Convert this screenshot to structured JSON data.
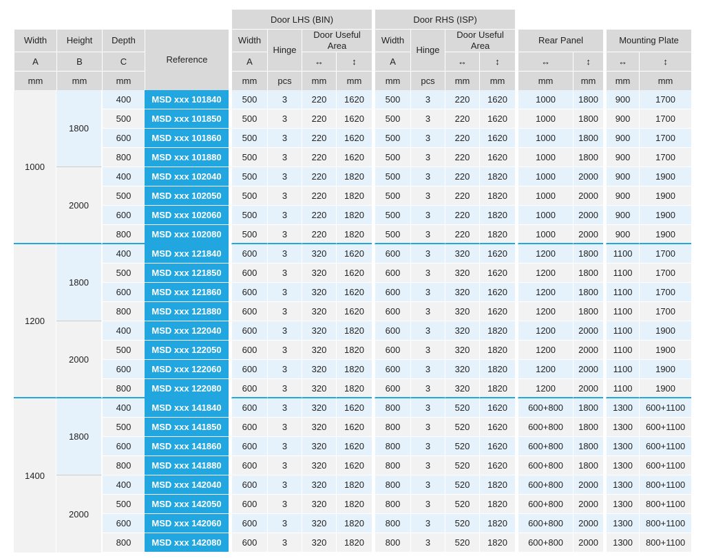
{
  "headers": {
    "width": "Width",
    "height": "Height",
    "depth": "Depth",
    "reference": "Reference",
    "a": "A",
    "b": "B",
    "c": "C",
    "mm": "mm",
    "pcs": "pcs",
    "door_lhs": "Door LHS (BIN)",
    "door_rhs": "Door RHS (ISP)",
    "door_width": "Width",
    "hinge": "Hinge",
    "door_useful_area": "Door Useful Area",
    "rear_panel": "Rear Panel",
    "mounting_plate": "Mounting Plate",
    "horizontal_icon": "↔",
    "vertical_icon": "↕"
  },
  "width_groups": [
    {
      "width": "1000",
      "height_groups": [
        {
          "height": "1800",
          "rows": [
            [
              "400",
              "MSD xxx 101840",
              "500",
              "3",
              "220",
              "1620",
              "500",
              "3",
              "220",
              "1620",
              "1000",
              "1800",
              "900",
              "1700"
            ],
            [
              "500",
              "MSD xxx 101850",
              "500",
              "3",
              "220",
              "1620",
              "500",
              "3",
              "220",
              "1620",
              "1000",
              "1800",
              "900",
              "1700"
            ],
            [
              "600",
              "MSD xxx 101860",
              "500",
              "3",
              "220",
              "1620",
              "500",
              "3",
              "220",
              "1620",
              "1000",
              "1800",
              "900",
              "1700"
            ],
            [
              "800",
              "MSD xxx 101880",
              "500",
              "3",
              "220",
              "1620",
              "500",
              "3",
              "220",
              "1620",
              "1000",
              "1800",
              "900",
              "1700"
            ]
          ]
        },
        {
          "height": "2000",
          "rows": [
            [
              "400",
              "MSD xxx 102040",
              "500",
              "3",
              "220",
              "1820",
              "500",
              "3",
              "220",
              "1820",
              "1000",
              "2000",
              "900",
              "1900"
            ],
            [
              "500",
              "MSD xxx 102050",
              "500",
              "3",
              "220",
              "1820",
              "500",
              "3",
              "220",
              "1820",
              "1000",
              "2000",
              "900",
              "1900"
            ],
            [
              "600",
              "MSD xxx 102060",
              "500",
              "3",
              "220",
              "1820",
              "500",
              "3",
              "220",
              "1820",
              "1000",
              "2000",
              "900",
              "1900"
            ],
            [
              "800",
              "MSD xxx 102080",
              "500",
              "3",
              "220",
              "1820",
              "500",
              "3",
              "220",
              "1820",
              "1000",
              "2000",
              "900",
              "1900"
            ]
          ]
        }
      ]
    },
    {
      "width": "1200",
      "height_groups": [
        {
          "height": "1800",
          "rows": [
            [
              "400",
              "MSD xxx 121840",
              "600",
              "3",
              "320",
              "1620",
              "600",
              "3",
              "320",
              "1620",
              "1200",
              "1800",
              "1100",
              "1700"
            ],
            [
              "500",
              "MSD xxx 121850",
              "600",
              "3",
              "320",
              "1620",
              "600",
              "3",
              "320",
              "1620",
              "1200",
              "1800",
              "1100",
              "1700"
            ],
            [
              "600",
              "MSD xxx 121860",
              "600",
              "3",
              "320",
              "1620",
              "600",
              "3",
              "320",
              "1620",
              "1200",
              "1800",
              "1100",
              "1700"
            ],
            [
              "800",
              "MSD xxx 121880",
              "600",
              "3",
              "320",
              "1620",
              "600",
              "3",
              "320",
              "1620",
              "1200",
              "1800",
              "1100",
              "1700"
            ]
          ]
        },
        {
          "height": "2000",
          "rows": [
            [
              "400",
              "MSD xxx 122040",
              "600",
              "3",
              "320",
              "1820",
              "600",
              "3",
              "320",
              "1820",
              "1200",
              "2000",
              "1100",
              "1900"
            ],
            [
              "500",
              "MSD xxx 122050",
              "600",
              "3",
              "320",
              "1820",
              "600",
              "3",
              "320",
              "1820",
              "1200",
              "2000",
              "1100",
              "1900"
            ],
            [
              "600",
              "MSD xxx 122060",
              "600",
              "3",
              "320",
              "1820",
              "600",
              "3",
              "320",
              "1820",
              "1200",
              "2000",
              "1100",
              "1900"
            ],
            [
              "800",
              "MSD xxx 122080",
              "600",
              "3",
              "320",
              "1820",
              "600",
              "3",
              "320",
              "1820",
              "1200",
              "2000",
              "1100",
              "1900"
            ]
          ]
        }
      ]
    },
    {
      "width": "1400",
      "height_groups": [
        {
          "height": "1800",
          "rows": [
            [
              "400",
              "MSD xxx 141840",
              "600",
              "3",
              "320",
              "1620",
              "800",
              "3",
              "520",
              "1620",
              "600+800",
              "1800",
              "1300",
              "600+1100"
            ],
            [
              "500",
              "MSD xxx 141850",
              "600",
              "3",
              "320",
              "1620",
              "800",
              "3",
              "520",
              "1620",
              "600+800",
              "1800",
              "1300",
              "600+1100"
            ],
            [
              "600",
              "MSD xxx 141860",
              "600",
              "3",
              "320",
              "1620",
              "800",
              "3",
              "520",
              "1620",
              "600+800",
              "1800",
              "1300",
              "600+1100"
            ],
            [
              "800",
              "MSD xxx 141880",
              "600",
              "3",
              "320",
              "1620",
              "800",
              "3",
              "520",
              "1620",
              "600+800",
              "1800",
              "1300",
              "600+1100"
            ]
          ]
        },
        {
          "height": "2000",
          "rows": [
            [
              "400",
              "MSD xxx 142040",
              "600",
              "3",
              "320",
              "1820",
              "800",
              "3",
              "520",
              "1820",
              "600+800",
              "2000",
              "1300",
              "800+1100"
            ],
            [
              "500",
              "MSD xxx 142050",
              "600",
              "3",
              "320",
              "1820",
              "800",
              "3",
              "520",
              "1820",
              "600+800",
              "2000",
              "1300",
              "800+1100"
            ],
            [
              "600",
              "MSD xxx 142060",
              "600",
              "3",
              "320",
              "1820",
              "800",
              "3",
              "520",
              "1820",
              "600+800",
              "2000",
              "1300",
              "800+1100"
            ],
            [
              "800",
              "MSD xxx 142080",
              "600",
              "3",
              "320",
              "1820",
              "800",
              "3",
              "520",
              "1820",
              "600+800",
              "2000",
              "1300",
              "800+1100"
            ]
          ]
        }
      ]
    }
  ],
  "colors": {
    "accent": "#22a6e0",
    "header": "#d9d9d9",
    "row_blue": "#e6f2fb",
    "row_grey": "#f2f2f2"
  }
}
